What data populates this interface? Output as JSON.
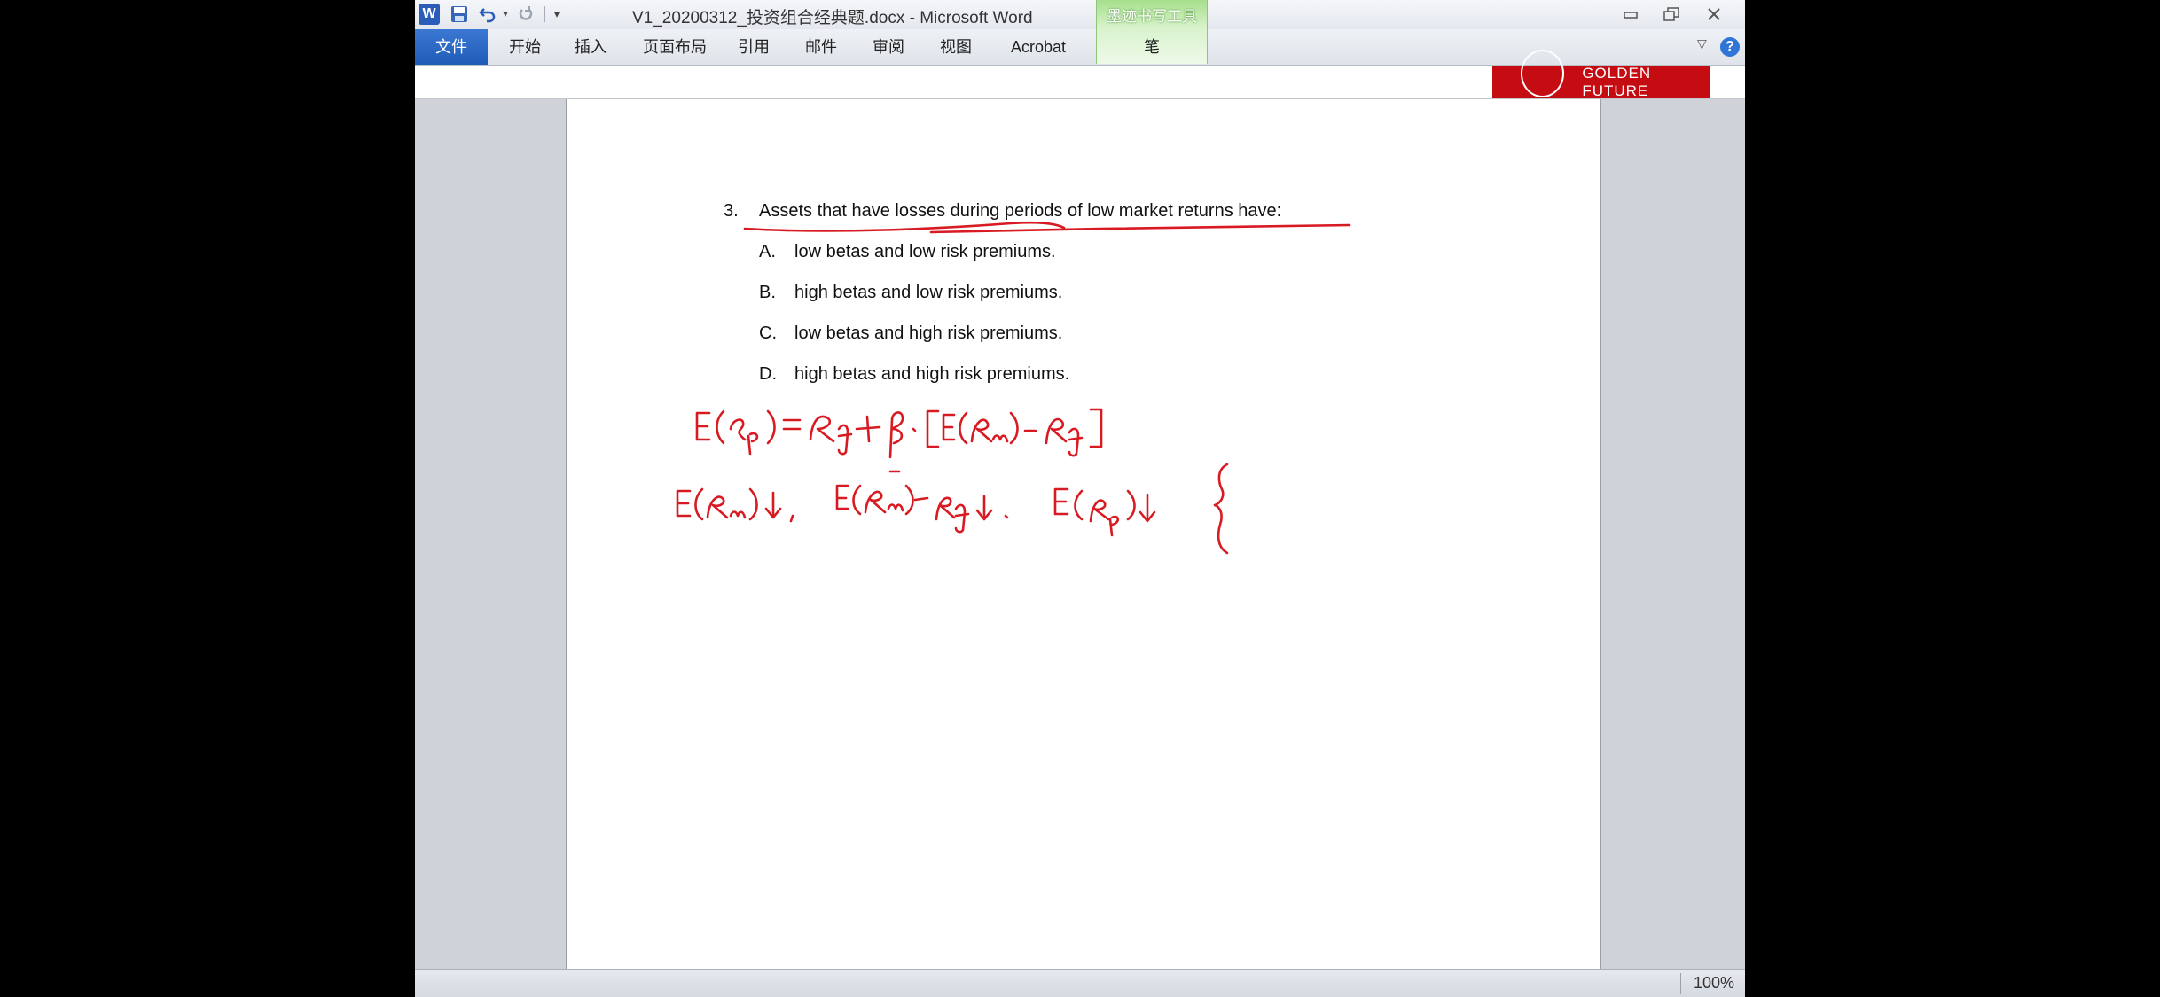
{
  "window": {
    "title": "V1_20200312_投资组合经典题.docx  -  Microsoft Word",
    "app_icon": "W"
  },
  "quick_access": {
    "save_icon": "save-icon",
    "undo_icon": "undo-icon",
    "redo_icon": "redo-icon",
    "customize_icon": "customize-icon"
  },
  "context_tab": {
    "group": "墨迹书写工具",
    "tab": "笔",
    "color": "#a6df8c"
  },
  "ribbon_tabs": [
    "文件",
    "开始",
    "插入",
    "页面布局",
    "引用",
    "邮件",
    "审阅",
    "视图",
    "Acrobat"
  ],
  "window_controls": {
    "minimize": "▭",
    "restore": "🗗",
    "close": "✕"
  },
  "banner": {
    "text": "GOLDEN FUTURE",
    "color": "#c40c12"
  },
  "question": {
    "number": "3.",
    "stem": "Assets that have losses during periods of low market returns have:",
    "options": [
      {
        "letter": "A.",
        "text": "low betas and low risk premiums."
      },
      {
        "letter": "B.",
        "text": "high betas and low risk premiums."
      },
      {
        "letter": "C.",
        "text": "low betas and high risk premiums."
      },
      {
        "letter": "D.",
        "text": "high betas and high risk premiums."
      }
    ]
  },
  "ink_color": "#d81b22",
  "status": {
    "zoom": "100%"
  }
}
